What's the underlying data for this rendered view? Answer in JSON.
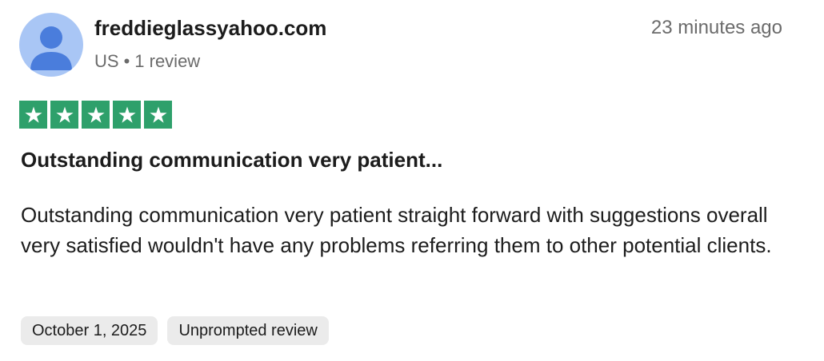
{
  "reviewer": {
    "name": "freddieglassyahoo.com",
    "country": "US",
    "separator": "•",
    "review_count": "1 review",
    "avatar_icon": "user-silhouette-icon"
  },
  "review": {
    "posted_ago": "23 minutes ago",
    "rating": 5,
    "rating_max": 5,
    "star_icon": "star-icon",
    "title": "Outstanding communication very patient...",
    "body": "Outstanding communication very patient straight forward with suggestions overall very satisfied wouldn't have any problems referring them to other potential clients.",
    "experience_date": "October 1, 2025",
    "label": "Unprompted review"
  },
  "colors": {
    "star_green": "#2ea06b",
    "avatar_bg": "#a9c6f5",
    "avatar_fg": "#4a7ddc",
    "muted_text": "#6b6b6b",
    "tag_bg": "#ebebeb"
  }
}
